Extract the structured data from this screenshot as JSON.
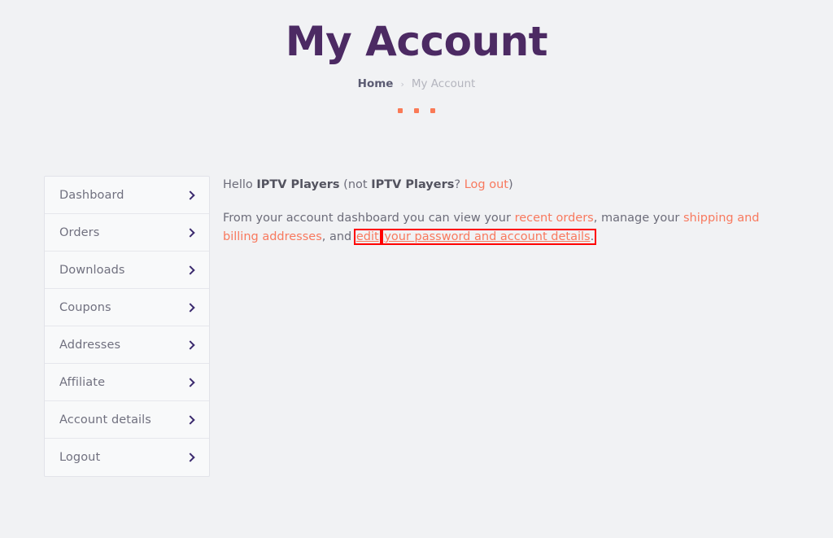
{
  "header": {
    "title": "My Account",
    "breadcrumb": {
      "home_label": "Home",
      "separator": "›",
      "current_label": "My Account"
    },
    "dots_count": 3,
    "dot_color": "#fa7a56",
    "title_color": "#4c2a63"
  },
  "sidebar": {
    "items": [
      {
        "label": "Dashboard",
        "icon": "chevron-right-icon"
      },
      {
        "label": "Orders",
        "icon": "chevron-right-icon"
      },
      {
        "label": "Downloads",
        "icon": "chevron-right-icon"
      },
      {
        "label": "Coupons",
        "icon": "chevron-right-icon"
      },
      {
        "label": "Addresses",
        "icon": "chevron-right-icon"
      },
      {
        "label": "Affiliate",
        "icon": "chevron-right-icon"
      },
      {
        "label": "Account details",
        "icon": "chevron-right-icon"
      },
      {
        "label": "Logout",
        "icon": "chevron-right-icon"
      }
    ]
  },
  "content": {
    "greeting": {
      "hello_prefix": "Hello ",
      "user_name": "IPTV Players",
      "not_prefix": " (not ",
      "not_user_name": "IPTV Players",
      "question_mark": "? ",
      "logout_link": "Log out",
      "closing_paren": ")"
    },
    "dashboard_text": {
      "part1": "From your account dashboard you can view your ",
      "link_recent_orders": "recent orders",
      "part2": ", manage your ",
      "link_addresses": "shipping and billing addresses",
      "part3": ", and ",
      "link_edit": "edit",
      "link_edit_rest": "your password and account details",
      "period": "."
    }
  },
  "annotations": {
    "highlight_color": "#ff0000",
    "boxes": [
      "edit",
      "your password and account details."
    ]
  },
  "colors": {
    "page_background": "#f1f2f4",
    "sidebar_background": "#f8f9fa",
    "link_accent": "#f8795e",
    "body_text": "#6d6d7a",
    "chevron": "#3b2a6e"
  }
}
